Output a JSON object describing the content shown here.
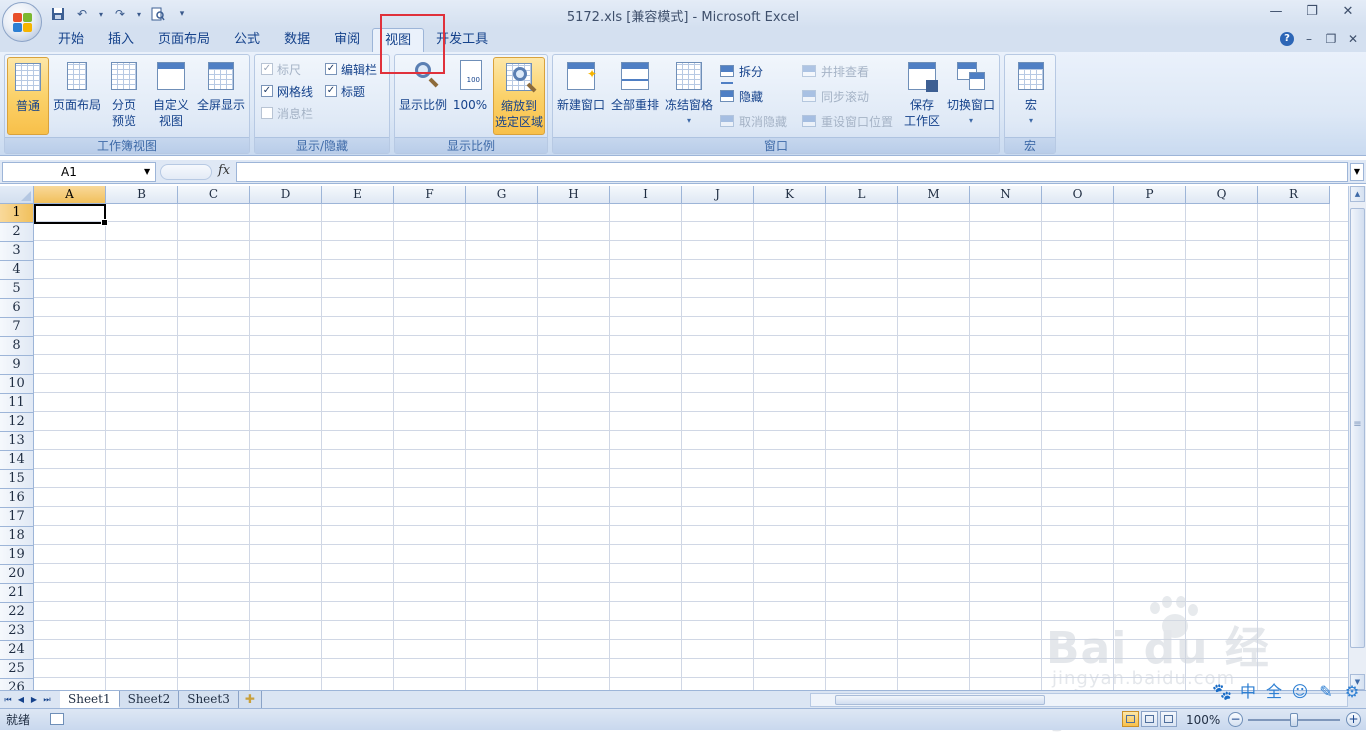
{
  "window": {
    "title": "5172.xls  [兼容模式] - Microsoft Excel",
    "controls": [
      "—",
      "❐",
      "✕"
    ]
  },
  "tabs": [
    {
      "label": "开始",
      "active": false
    },
    {
      "label": "插入",
      "active": false
    },
    {
      "label": "页面布局",
      "active": false
    },
    {
      "label": "公式",
      "active": false
    },
    {
      "label": "数据",
      "active": false
    },
    {
      "label": "审阅",
      "active": false
    },
    {
      "label": "视图",
      "active": true
    },
    {
      "label": "开发工具",
      "active": false
    }
  ],
  "ribbon": {
    "workbook_views": {
      "label": "工作簿视图",
      "normal": "普通",
      "page_layout": "页面布局",
      "page_break_1": "分页",
      "page_break_2": "预览",
      "custom_1": "自定义",
      "custom_2": "视图",
      "fullscreen": "全屏显示"
    },
    "show_hide": {
      "label": "显示/隐藏",
      "ruler": {
        "label": "标尺",
        "checked": true,
        "enabled": false
      },
      "gridlines": {
        "label": "网格线",
        "checked": true,
        "enabled": true
      },
      "message_bar": {
        "label": "消息栏",
        "checked": false,
        "enabled": false
      },
      "formula_bar": {
        "label": "编辑栏",
        "checked": true,
        "enabled": true
      },
      "headings": {
        "label": "标题",
        "checked": true,
        "enabled": true
      }
    },
    "zoom": {
      "label": "显示比例",
      "zoom": "显示比例",
      "hundred": "100%",
      "zoom_sel_1": "缩放到",
      "zoom_sel_2": "选定区域"
    },
    "window": {
      "label": "窗口",
      "new_window": "新建窗口",
      "arrange_all": "全部重排",
      "freeze": "冻结窗格",
      "split": "拆分",
      "hide": "隐藏",
      "unhide": "取消隐藏",
      "side_by_side": "并排查看",
      "sync_scroll": "同步滚动",
      "reset_pos": "重设窗口位置",
      "save_ws_1": "保存",
      "save_ws_2": "工作区",
      "switch_win": "切换窗口"
    },
    "macros": {
      "label": "宏",
      "macro": "宏"
    }
  },
  "formula_bar": {
    "name_box": "A1",
    "fx": "fx",
    "value": ""
  },
  "grid": {
    "columns": [
      "A",
      "B",
      "C",
      "D",
      "E",
      "F",
      "G",
      "H",
      "I",
      "J",
      "K",
      "L",
      "M",
      "N",
      "O",
      "P",
      "Q",
      "R"
    ],
    "rows": [
      "1",
      "2",
      "3",
      "4",
      "5",
      "6",
      "7",
      "8",
      "9",
      "10",
      "11",
      "12",
      "13",
      "14",
      "15",
      "16",
      "17",
      "18",
      "19",
      "20",
      "21",
      "22",
      "23",
      "24",
      "25",
      "26"
    ],
    "active_cell": "A1"
  },
  "sheets": [
    {
      "label": "Sheet1",
      "active": true
    },
    {
      "label": "Sheet2",
      "active": false
    },
    {
      "label": "Sheet3",
      "active": false
    }
  ],
  "status": {
    "ready": "就绪",
    "zoom": "100%"
  },
  "watermark": {
    "logo": "Bai du 经验",
    "url": "jingyan.baidu.com"
  },
  "colors": {
    "highlight_box": "#e0313b",
    "ribbon_text": "#15428b",
    "active_button": "#fbd26a"
  }
}
